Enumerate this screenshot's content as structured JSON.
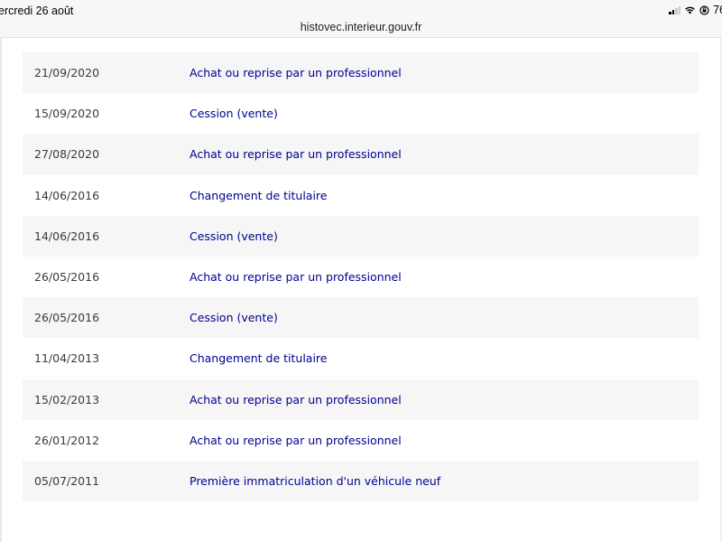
{
  "status_bar": {
    "time": "ercredi 26 août",
    "battery_text": "76"
  },
  "browser": {
    "url": "histovec.interieur.gouv.fr"
  },
  "history": {
    "partial_row": {
      "date": "",
      "event": ""
    },
    "rows": [
      {
        "date": "21/09/2020",
        "event": "Achat ou reprise par un professionnel"
      },
      {
        "date": "15/09/2020",
        "event": "Cession (vente)"
      },
      {
        "date": "27/08/2020",
        "event": "Achat ou reprise par un professionnel"
      },
      {
        "date": "14/06/2016",
        "event": "Changement de titulaire"
      },
      {
        "date": "14/06/2016",
        "event": "Cession (vente)"
      },
      {
        "date": "26/05/2016",
        "event": "Achat ou reprise par un professionnel"
      },
      {
        "date": "26/05/2016",
        "event": "Cession (vente)"
      },
      {
        "date": "11/04/2013",
        "event": "Changement de titulaire"
      },
      {
        "date": "15/02/2013",
        "event": "Achat ou reprise par un professionnel"
      },
      {
        "date": "26/01/2012",
        "event": "Achat ou reprise par un professionnel"
      },
      {
        "date": "05/07/2011",
        "event": "Première immatriculation d'un véhicule neuf"
      }
    ]
  },
  "colors": {
    "event_text": "#000091",
    "date_text": "#3a3a3a",
    "row_shade": "#f6f6f6"
  }
}
